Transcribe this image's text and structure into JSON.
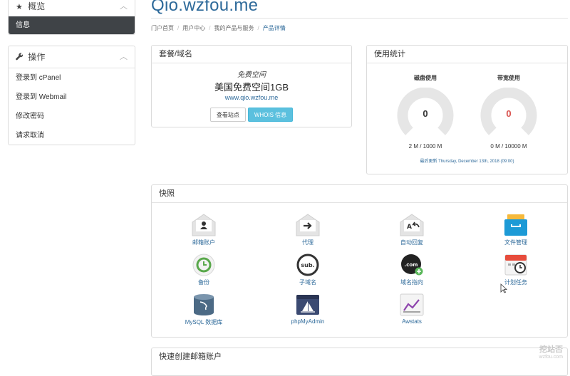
{
  "sidebar": {
    "overview": {
      "title": "概览",
      "active_item": "信息"
    },
    "actions": {
      "title": "操作",
      "links": [
        "登录到 cPanel",
        "登录到 Webmail",
        "修改密码",
        "请求取消"
      ]
    }
  },
  "header": {
    "title": "Qio.wzfou.me",
    "breadcrumb": [
      "门户首页",
      "用户中心",
      "我的产品与服务",
      "产品详情"
    ]
  },
  "product": {
    "heading": "套餐/域名",
    "group": "免费空间",
    "name": "美国免费空间1GB",
    "domain": "www.qio.wzfou.me",
    "visit_button": "查看站点",
    "whois_button": "WHOIS 信息"
  },
  "usage": {
    "heading": "使用统计",
    "disk": {
      "label": "磁盘使用",
      "percent": "0",
      "detail": "2 M / 1000 M"
    },
    "bandwidth": {
      "label": "带宽使用",
      "percent": "0",
      "detail": "0 M / 10000 M"
    },
    "updated": "最后更新 Thursday, December 13th, 2018 (09:00)"
  },
  "quick": {
    "heading": "快照",
    "items": [
      {
        "label": "邮箱账户",
        "icon": "mail-account-icon"
      },
      {
        "label": "代理",
        "icon": "mail-forwarder-icon"
      },
      {
        "label": "自动回复",
        "icon": "autoresponder-icon"
      },
      {
        "label": "文件管理",
        "icon": "file-manager-icon"
      },
      {
        "label": "备份",
        "icon": "backup-icon"
      },
      {
        "label": "子域名",
        "icon": "subdomain-icon"
      },
      {
        "label": "域名指向",
        "icon": "addon-domain-icon"
      },
      {
        "label": "计划任务",
        "icon": "cron-jobs-icon"
      },
      {
        "label": "MySQL 数据库",
        "icon": "mysql-database-icon"
      },
      {
        "label": "phpMyAdmin",
        "icon": "phpmyadmin-icon"
      },
      {
        "label": "Awstats",
        "icon": "awstats-icon"
      }
    ]
  },
  "create_mail": {
    "heading": "快速创建邮箱账户"
  },
  "watermark": {
    "line1": "挖站否",
    "line2": "wzfou.com"
  },
  "colors": {
    "accent": "#2e6a9a",
    "active_bg": "#3f4347",
    "info_button": "#5bc0de",
    "bandwidth_zero": "#d9534f"
  }
}
